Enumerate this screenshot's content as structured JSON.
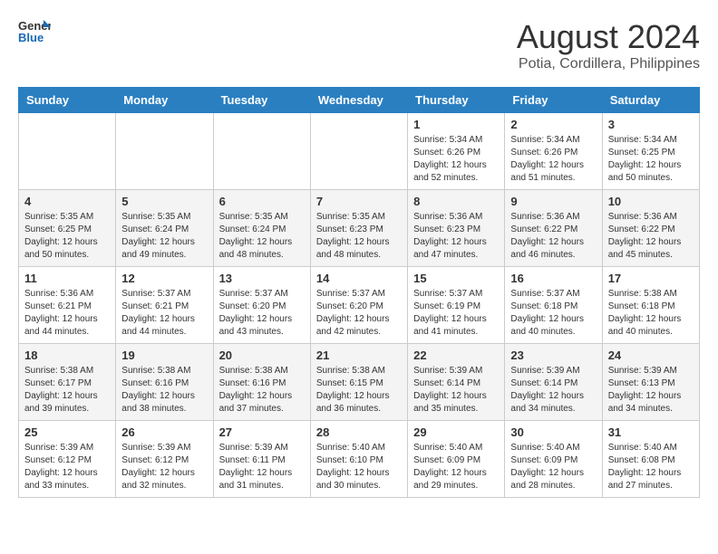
{
  "header": {
    "logo_line1": "General",
    "logo_line2": "Blue",
    "month_year": "August 2024",
    "location": "Potia, Cordillera, Philippines"
  },
  "days_of_week": [
    "Sunday",
    "Monday",
    "Tuesday",
    "Wednesday",
    "Thursday",
    "Friday",
    "Saturday"
  ],
  "weeks": [
    [
      {
        "day": "",
        "info": ""
      },
      {
        "day": "",
        "info": ""
      },
      {
        "day": "",
        "info": ""
      },
      {
        "day": "",
        "info": ""
      },
      {
        "day": "1",
        "info": "Sunrise: 5:34 AM\nSunset: 6:26 PM\nDaylight: 12 hours\nand 52 minutes."
      },
      {
        "day": "2",
        "info": "Sunrise: 5:34 AM\nSunset: 6:26 PM\nDaylight: 12 hours\nand 51 minutes."
      },
      {
        "day": "3",
        "info": "Sunrise: 5:34 AM\nSunset: 6:25 PM\nDaylight: 12 hours\nand 50 minutes."
      }
    ],
    [
      {
        "day": "4",
        "info": "Sunrise: 5:35 AM\nSunset: 6:25 PM\nDaylight: 12 hours\nand 50 minutes."
      },
      {
        "day": "5",
        "info": "Sunrise: 5:35 AM\nSunset: 6:24 PM\nDaylight: 12 hours\nand 49 minutes."
      },
      {
        "day": "6",
        "info": "Sunrise: 5:35 AM\nSunset: 6:24 PM\nDaylight: 12 hours\nand 48 minutes."
      },
      {
        "day": "7",
        "info": "Sunrise: 5:35 AM\nSunset: 6:23 PM\nDaylight: 12 hours\nand 48 minutes."
      },
      {
        "day": "8",
        "info": "Sunrise: 5:36 AM\nSunset: 6:23 PM\nDaylight: 12 hours\nand 47 minutes."
      },
      {
        "day": "9",
        "info": "Sunrise: 5:36 AM\nSunset: 6:22 PM\nDaylight: 12 hours\nand 46 minutes."
      },
      {
        "day": "10",
        "info": "Sunrise: 5:36 AM\nSunset: 6:22 PM\nDaylight: 12 hours\nand 45 minutes."
      }
    ],
    [
      {
        "day": "11",
        "info": "Sunrise: 5:36 AM\nSunset: 6:21 PM\nDaylight: 12 hours\nand 44 minutes."
      },
      {
        "day": "12",
        "info": "Sunrise: 5:37 AM\nSunset: 6:21 PM\nDaylight: 12 hours\nand 44 minutes."
      },
      {
        "day": "13",
        "info": "Sunrise: 5:37 AM\nSunset: 6:20 PM\nDaylight: 12 hours\nand 43 minutes."
      },
      {
        "day": "14",
        "info": "Sunrise: 5:37 AM\nSunset: 6:20 PM\nDaylight: 12 hours\nand 42 minutes."
      },
      {
        "day": "15",
        "info": "Sunrise: 5:37 AM\nSunset: 6:19 PM\nDaylight: 12 hours\nand 41 minutes."
      },
      {
        "day": "16",
        "info": "Sunrise: 5:37 AM\nSunset: 6:18 PM\nDaylight: 12 hours\nand 40 minutes."
      },
      {
        "day": "17",
        "info": "Sunrise: 5:38 AM\nSunset: 6:18 PM\nDaylight: 12 hours\nand 40 minutes."
      }
    ],
    [
      {
        "day": "18",
        "info": "Sunrise: 5:38 AM\nSunset: 6:17 PM\nDaylight: 12 hours\nand 39 minutes."
      },
      {
        "day": "19",
        "info": "Sunrise: 5:38 AM\nSunset: 6:16 PM\nDaylight: 12 hours\nand 38 minutes."
      },
      {
        "day": "20",
        "info": "Sunrise: 5:38 AM\nSunset: 6:16 PM\nDaylight: 12 hours\nand 37 minutes."
      },
      {
        "day": "21",
        "info": "Sunrise: 5:38 AM\nSunset: 6:15 PM\nDaylight: 12 hours\nand 36 minutes."
      },
      {
        "day": "22",
        "info": "Sunrise: 5:39 AM\nSunset: 6:14 PM\nDaylight: 12 hours\nand 35 minutes."
      },
      {
        "day": "23",
        "info": "Sunrise: 5:39 AM\nSunset: 6:14 PM\nDaylight: 12 hours\nand 34 minutes."
      },
      {
        "day": "24",
        "info": "Sunrise: 5:39 AM\nSunset: 6:13 PM\nDaylight: 12 hours\nand 34 minutes."
      }
    ],
    [
      {
        "day": "25",
        "info": "Sunrise: 5:39 AM\nSunset: 6:12 PM\nDaylight: 12 hours\nand 33 minutes."
      },
      {
        "day": "26",
        "info": "Sunrise: 5:39 AM\nSunset: 6:12 PM\nDaylight: 12 hours\nand 32 minutes."
      },
      {
        "day": "27",
        "info": "Sunrise: 5:39 AM\nSunset: 6:11 PM\nDaylight: 12 hours\nand 31 minutes."
      },
      {
        "day": "28",
        "info": "Sunrise: 5:40 AM\nSunset: 6:10 PM\nDaylight: 12 hours\nand 30 minutes."
      },
      {
        "day": "29",
        "info": "Sunrise: 5:40 AM\nSunset: 6:09 PM\nDaylight: 12 hours\nand 29 minutes."
      },
      {
        "day": "30",
        "info": "Sunrise: 5:40 AM\nSunset: 6:09 PM\nDaylight: 12 hours\nand 28 minutes."
      },
      {
        "day": "31",
        "info": "Sunrise: 5:40 AM\nSunset: 6:08 PM\nDaylight: 12 hours\nand 27 minutes."
      }
    ]
  ]
}
